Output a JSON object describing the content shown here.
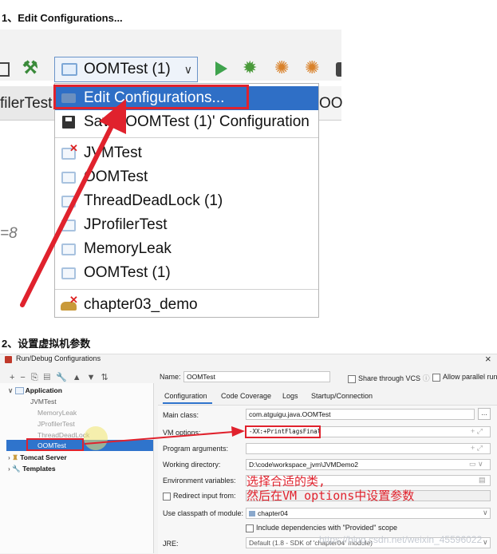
{
  "steps": {
    "step1": "1、Edit Configurations...",
    "step2": "2、设置虚拟机参数"
  },
  "toolbar": {
    "run_config_selected": "OOMTest (1)",
    "left_tab_partial": "filerTest",
    "right_tab_partial": "OO",
    "side_text_partial": "=8"
  },
  "run_menu": {
    "items": [
      {
        "label": "Edit Configurations...",
        "icon": "edit-config-icon",
        "selected": true
      },
      {
        "label": "Save 'OOMTest (1)' Configuration",
        "icon": "save-icon",
        "selected": false
      },
      {
        "label": "JVMTest",
        "icon": "app-config-error-icon",
        "selected": false
      },
      {
        "label": "OOMTest",
        "icon": "app-config-icon",
        "selected": false
      },
      {
        "label": "ThreadDeadLock (1)",
        "icon": "app-config-icon",
        "selected": false
      },
      {
        "label": "JProfilerTest",
        "icon": "app-config-icon",
        "selected": false
      },
      {
        "label": "MemoryLeak",
        "icon": "app-config-icon",
        "selected": false
      },
      {
        "label": "OOMTest (1)",
        "icon": "app-config-icon",
        "selected": false
      },
      {
        "label": "chapter03_demo",
        "icon": "tomcat-error-icon",
        "selected": false
      }
    ]
  },
  "dialog": {
    "title": "Run/Debug Configurations",
    "close_glyph": "×",
    "name_label": "Name:",
    "name_value": "OOMTest",
    "share_label": "Share through VCS",
    "parallel_label": "Allow parallel run",
    "tabs": [
      "Configuration",
      "Code Coverage",
      "Logs",
      "Startup/Connection"
    ],
    "tree": {
      "application_label": "Application",
      "items": [
        "JVMTest",
        "MemoryLeak",
        "JProfilerTest",
        "ThreadDeadLock",
        "OOMTest"
      ],
      "selected": "OOMTest",
      "tomcat_label": "Tomcat Server",
      "templates_label": "Templates"
    },
    "form": {
      "main_class_label": "Main class:",
      "main_class_value": "com.atguigu.java.OOMTest",
      "vm_options_label": "VM options:",
      "vm_options_value": "-XX:+PrintFlagsFinal",
      "program_args_label": "Program arguments:",
      "working_dir_label": "Working directory:",
      "working_dir_value": "D:\\code\\workspace_jvm\\JVMDemo2",
      "env_vars_label": "Environment variables:",
      "redirect_label": "Redirect input from:",
      "classpath_label": "Use classpath of module:",
      "classpath_value": "chapter04",
      "include_deps_label": "Include dependencies with \"Provided\" scope",
      "jre_label": "JRE:",
      "jre_value": "Default (1.8 - SDK of 'chapter04' module)"
    }
  },
  "annotation": {
    "line1": "选择合适的类,",
    "line2": "然后在VM options中设置参数",
    "color": "#e0222d"
  },
  "watermark": "https://blog.csdn.net/weixin_45596022"
}
